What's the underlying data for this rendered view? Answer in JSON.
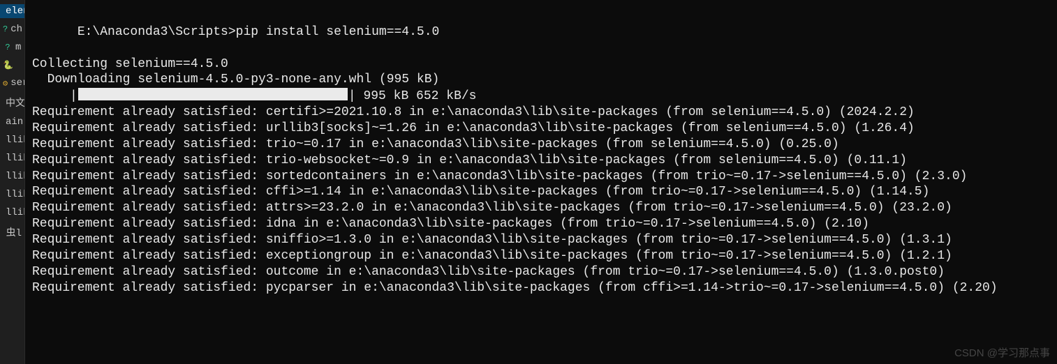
{
  "sidebar": {
    "items": [
      {
        "label": "elen",
        "selected": true,
        "icon": ""
      },
      {
        "label": "ch",
        "icon": "question"
      },
      {
        "label": "m",
        "icon": "question"
      },
      {
        "label": "",
        "icon": "py"
      },
      {
        "label": "ser-",
        "icon": "gear"
      },
      {
        "label": "中文",
        "icon": ""
      },
      {
        "label": "ain",
        "icon": ""
      },
      {
        "label": "llib",
        "icon": ""
      },
      {
        "label": "llib",
        "icon": ""
      },
      {
        "label": "llib",
        "icon": ""
      },
      {
        "label": "llib",
        "icon": ""
      },
      {
        "label": "llib",
        "icon": ""
      },
      {
        "label": "虫l",
        "icon": ""
      }
    ]
  },
  "terminal": {
    "prompt": "E:\\Anaconda3\\Scripts>",
    "command": "pip install selenium==4.5.0",
    "collecting": "Collecting selenium==4.5.0",
    "downloading": "  Downloading selenium-4.5.0-py3-none-any.whl (995 kB)",
    "progress": {
      "percent": 100,
      "indent": "     ",
      "status": " 995 kB 652 kB/s"
    },
    "lines": [
      "Requirement already satisfied: certifi>=2021.10.8 in e:\\anaconda3\\lib\\site-packages (from selenium==4.5.0) (2024.2.2)",
      "Requirement already satisfied: urllib3[socks]~=1.26 in e:\\anaconda3\\lib\\site-packages (from selenium==4.5.0) (1.26.4)",
      "Requirement already satisfied: trio~=0.17 in e:\\anaconda3\\lib\\site-packages (from selenium==4.5.0) (0.25.0)",
      "Requirement already satisfied: trio-websocket~=0.9 in e:\\anaconda3\\lib\\site-packages (from selenium==4.5.0) (0.11.1)",
      "Requirement already satisfied: sortedcontainers in e:\\anaconda3\\lib\\site-packages (from trio~=0.17->selenium==4.5.0) (2.3.0)",
      "Requirement already satisfied: cffi>=1.14 in e:\\anaconda3\\lib\\site-packages (from trio~=0.17->selenium==4.5.0) (1.14.5)",
      "Requirement already satisfied: attrs>=23.2.0 in e:\\anaconda3\\lib\\site-packages (from trio~=0.17->selenium==4.5.0) (23.2.0)",
      "Requirement already satisfied: idna in e:\\anaconda3\\lib\\site-packages (from trio~=0.17->selenium==4.5.0) (2.10)",
      "Requirement already satisfied: sniffio>=1.3.0 in e:\\anaconda3\\lib\\site-packages (from trio~=0.17->selenium==4.5.0) (1.3.1)",
      "Requirement already satisfied: exceptiongroup in e:\\anaconda3\\lib\\site-packages (from trio~=0.17->selenium==4.5.0) (1.2.1)",
      "Requirement already satisfied: outcome in e:\\anaconda3\\lib\\site-packages (from trio~=0.17->selenium==4.5.0) (1.3.0.post0)",
      "Requirement already satisfied: pycparser in e:\\anaconda3\\lib\\site-packages (from cffi>=1.14->trio~=0.17->selenium==4.5.0) (2.20)"
    ]
  },
  "watermark": "CSDN @学习那点事"
}
